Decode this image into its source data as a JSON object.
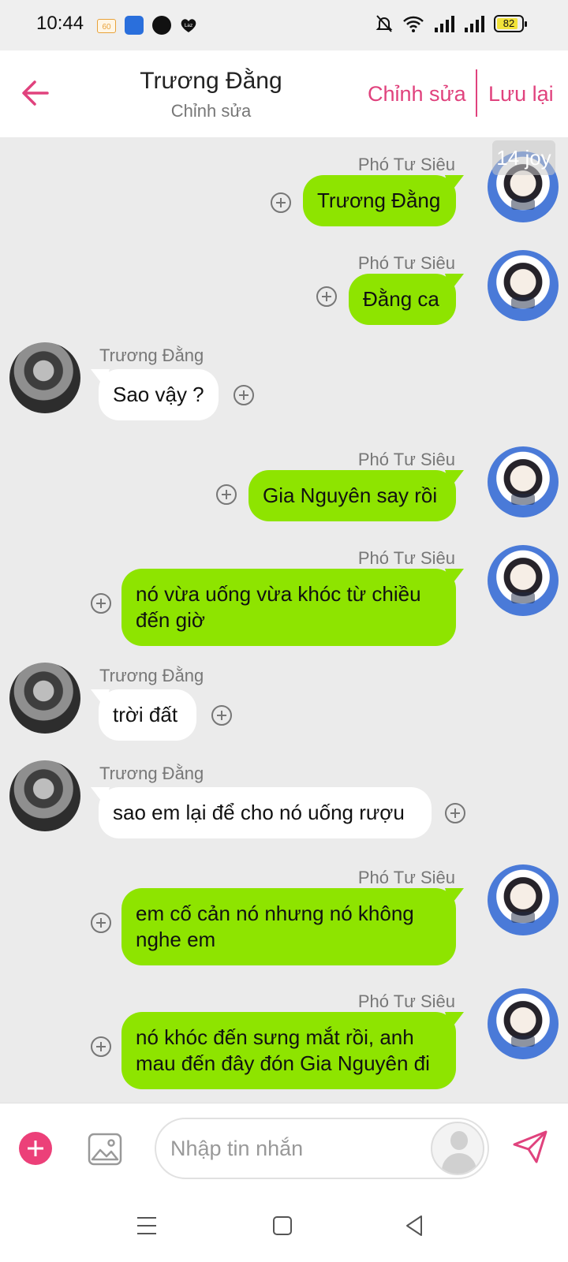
{
  "status_bar": {
    "time": "10:44",
    "notif_60": "60",
    "battery": "82"
  },
  "header": {
    "title": "Trương Đằng",
    "subtitle": "Chỉnh sửa",
    "edit_label": "Chỉnh sửa",
    "save_label": "Lưu lại",
    "accent": "#e0427d"
  },
  "watermark": "14 joy",
  "messages": [
    {
      "side": "me",
      "sender": "Phó Tư Siêu",
      "text": "Trương Đằng"
    },
    {
      "side": "me",
      "sender": "Phó Tư Siêu",
      "text": "Đằng ca"
    },
    {
      "side": "them",
      "sender": "Trương Đằng",
      "text": "Sao vậy ?"
    },
    {
      "side": "me",
      "sender": "Phó Tư Siêu",
      "text": "Gia Nguyên say rồi"
    },
    {
      "side": "me",
      "sender": "Phó Tư Siêu",
      "text": "nó vừa uống vừa khóc từ chiều đến giờ"
    },
    {
      "side": "them",
      "sender": "Trương Đằng",
      "text": "trời đất"
    },
    {
      "side": "them",
      "sender": "Trương Đằng",
      "text": "sao em lại để cho nó uống rượu"
    },
    {
      "side": "me",
      "sender": "Phó Tư Siêu",
      "text": "em cố cản nó nhưng nó không nghe em"
    },
    {
      "side": "me",
      "sender": "Phó Tư Siêu",
      "text": "nó khóc đến sưng mắt rồi, anh mau đến đây đón Gia Nguyên đi"
    }
  ],
  "input": {
    "placeholder": "Nhập tin nhắn"
  },
  "colors": {
    "my_bubble": "#8ee400",
    "their_bubble": "#ffffff",
    "chat_bg": "#ebebeb",
    "add_button": "#ec4079"
  }
}
